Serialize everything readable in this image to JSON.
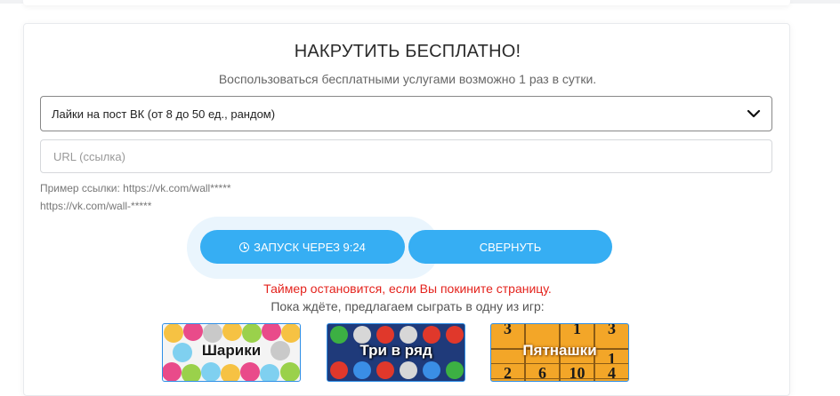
{
  "header": {
    "title": "НАКРУТИТЬ БЕСПЛАТНО!",
    "subtitle": "Воспользоваться бесплатными услугами возможно 1 раз в сутки."
  },
  "form": {
    "service_select_value": "Лайки на пост ВК (от 8 до 50 ед., рандом)",
    "url_placeholder": "URL (ссылка)",
    "hint_line1": "Пример ссылки: https://vk.com/wall*****",
    "hint_line2": "https://vk.com/wall-*****"
  },
  "buttons": {
    "start_label": "ЗАПУСК ЧЕРЕЗ 9:24",
    "collapse_label": "СВЕРНУТЬ"
  },
  "notes": {
    "timer_warning": "Таймер остановится, если Вы покините страницу.",
    "games_offer": "Пока ждёте, предлагаем сыграть в одну из игр:"
  },
  "games": [
    {
      "label": "Шарики",
      "icon": "balloons-icon"
    },
    {
      "label": "Три в ряд",
      "icon": "match-three-icon"
    },
    {
      "label": "Пятнашки",
      "icon": "fifteen-puzzle-icon"
    }
  ],
  "puzzle_numbers": [
    "3",
    "1",
    "3",
    "1",
    "2",
    "6",
    "10",
    "4"
  ],
  "colors": {
    "button": "#36aef3",
    "warning": "#e4231d",
    "game_border": "#2f8fe6"
  }
}
